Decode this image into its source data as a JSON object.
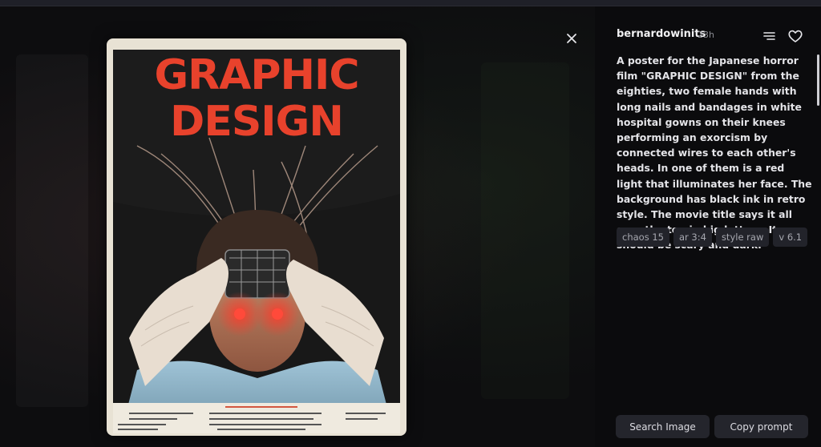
{
  "image": {
    "poster_title_line1": "GRAPHIC",
    "poster_title_line2": "DESIGN"
  },
  "icons": {
    "close": "close-icon",
    "menu": "menu-lines-icon",
    "like": "heart-icon"
  },
  "post": {
    "username": "bernardowinits",
    "time": "23h",
    "prompt": "A poster for the Japanese horror film \"GRAPHIC DESIGN\" from the eighties, two female hands with long nails and bandages in white hospital gowns on their knees performing an exorcism by connected wires to each other's heads. In one of them is a red light that illuminates her face. The background has black ink in retro style. The movie title says it all over the top in big letters. It should be scary and dark.",
    "tags": [
      {
        "label": "chaos 15"
      },
      {
        "label": "ar 3:4"
      },
      {
        "label": "style raw"
      },
      {
        "label": "v 6.1"
      }
    ]
  },
  "actions": {
    "search_label": "Search Image",
    "copy_label": "Copy prompt"
  },
  "colors": {
    "accent_red": "#e8422c",
    "panel_bg": "#0b0b0d",
    "tag_bg": "#22232a",
    "button_bg": "#24252c"
  }
}
